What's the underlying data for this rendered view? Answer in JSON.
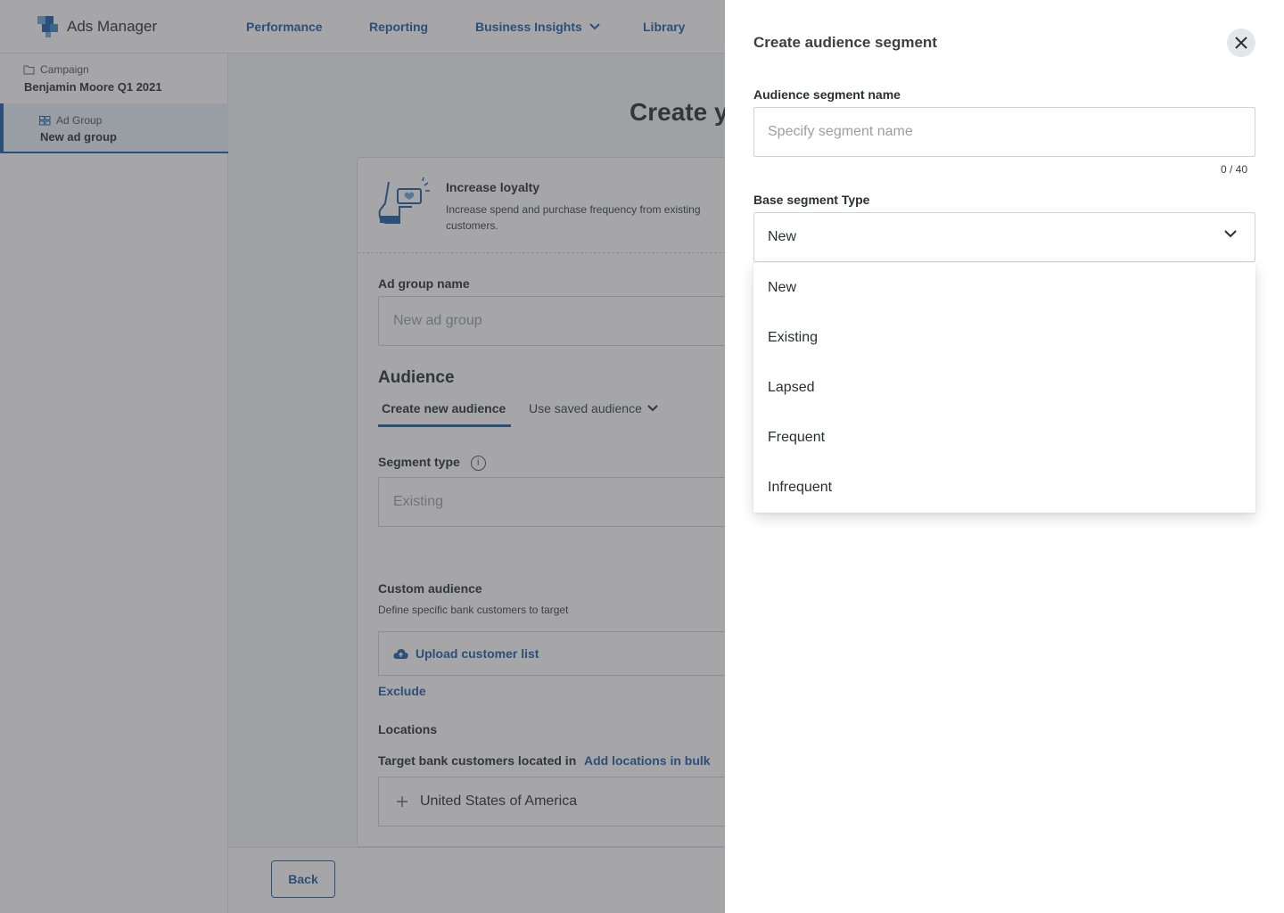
{
  "header": {
    "brand": "Ads Manager",
    "nav": [
      "Performance",
      "Reporting",
      "Business Insights",
      "Library"
    ]
  },
  "sidebar": {
    "campaign_label": "Campaign",
    "campaign_name": "Benjamin Moore Q1 2021",
    "adgroup_label": "Ad Group",
    "adgroup_name": "New ad group"
  },
  "main": {
    "title": "Create y",
    "objective": {
      "title": "Increase loyalty",
      "description": "Increase spend and purchase frequency from existing customers."
    },
    "ad_group_name_label": "Ad group name",
    "ad_group_name_placeholder": "New ad group",
    "audience_heading": "Audience",
    "tabs": [
      "Create new audience",
      "Use saved audience"
    ],
    "segment_type_label": "Segment type",
    "segment_type_value": "Existing",
    "custom_audience_label": "Custom audience",
    "custom_audience_desc": "Define specific bank customers to target",
    "upload_label": "Upload customer list",
    "exclude_label": "Exclude",
    "locations_label": "Locations",
    "target_text": "Target bank customers located in",
    "add_locations_link": "Add locations in bulk",
    "location_value": "United States of America",
    "back_button": "Back"
  },
  "drawer": {
    "title": "Create audience segment",
    "name_label": "Audience segment name",
    "name_placeholder": "Specify segment name",
    "counter": "0 / 40",
    "type_label": "Base segment Type",
    "type_selected": "New",
    "options": [
      "New",
      "Existing",
      "Lapsed",
      "Frequent",
      "Infrequent"
    ]
  },
  "colors": {
    "accent": "#1f5fa8",
    "overlay": "#3c3e42"
  }
}
